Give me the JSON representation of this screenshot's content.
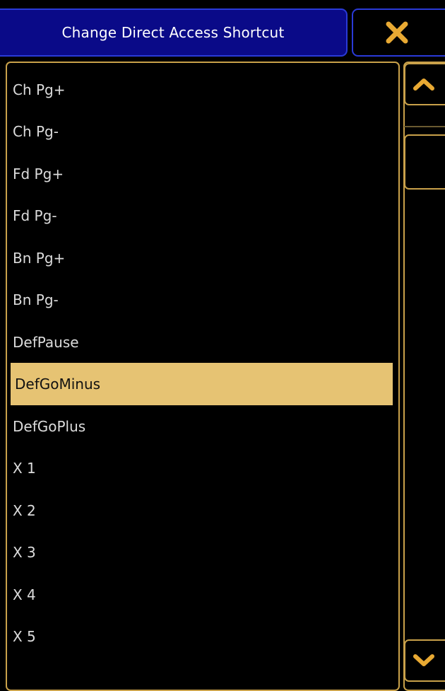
{
  "dialog": {
    "title": "Change Direct Access Shortcut"
  },
  "icons": {
    "close": "close-icon",
    "scroll_up": "chevron-up-icon",
    "scroll_down": "chevron-down-icon"
  },
  "colors": {
    "title_bg": "#0a0a88",
    "title_border": "#2a3ad8",
    "accent": "#e8a933",
    "panel_border": "#c9a14a",
    "selected_bg": "#e6c373"
  },
  "list": {
    "items": [
      {
        "label": "Ch Pg+"
      },
      {
        "label": "Ch Pg-"
      },
      {
        "label": "Fd Pg+"
      },
      {
        "label": "Fd Pg-"
      },
      {
        "label": "Bn Pg+"
      },
      {
        "label": "Bn Pg-"
      },
      {
        "label": "DefPause"
      },
      {
        "label": "DefGoMinus"
      },
      {
        "label": "DefGoPlus"
      },
      {
        "label": "X 1"
      },
      {
        "label": "X 2"
      },
      {
        "label": "X 3"
      },
      {
        "label": "X 4"
      },
      {
        "label": "X 5"
      }
    ],
    "selected_index": 7
  }
}
